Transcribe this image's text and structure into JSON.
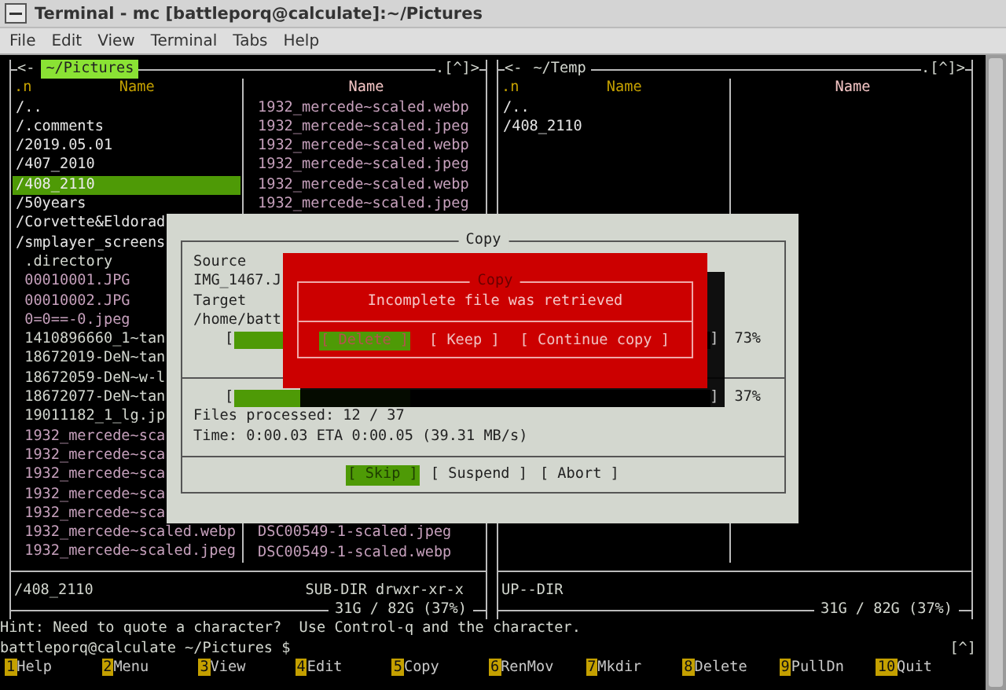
{
  "window": {
    "title": "Terminal - mc [battleporq@calculate]:~/Pictures"
  },
  "menu": [
    "File",
    "Edit",
    "View",
    "Terminal",
    "Tabs",
    "Help"
  ],
  "panels": [
    {
      "left_mark": "<-",
      "path": "~/Pictures",
      "selected": true,
      "right_mark": ".[^]>",
      "column_headers": [
        ".n",
        "Name",
        "Name"
      ],
      "column_1": [
        {
          "name": "/..",
          "kind": "dir",
          "selected": false
        },
        {
          "name": "/.comments",
          "kind": "dir",
          "selected": false
        },
        {
          "name": "/2019.05.01",
          "kind": "dir",
          "selected": false
        },
        {
          "name": "/407_2010",
          "kind": "dir",
          "selected": false
        },
        {
          "name": "/408_2110",
          "kind": "dir",
          "selected": true
        },
        {
          "name": "/50years",
          "kind": "dir",
          "selected": false
        },
        {
          "name": "/Corvette&Eldorad",
          "kind": "dir",
          "selected": false
        },
        {
          "name": "/smplayer_screens",
          "kind": "dir",
          "selected": false
        },
        {
          "name": ".directory",
          "kind": "file",
          "selected": false
        },
        {
          "name": "00010001.JPG",
          "kind": "image",
          "selected": false
        },
        {
          "name": "00010002.JPG",
          "kind": "image",
          "selected": false
        },
        {
          "name": "0=0==-0.jpeg",
          "kind": "image",
          "selected": false
        },
        {
          "name": "1410896660_1~tan",
          "kind": "file",
          "selected": false
        },
        {
          "name": "18672019-DeN~tan",
          "kind": "file",
          "selected": false
        },
        {
          "name": "18672059-DeN~w-l",
          "kind": "file",
          "selected": false
        },
        {
          "name": "18672077-DeN~tan",
          "kind": "file",
          "selected": false
        },
        {
          "name": "19011182_1_lg.jp",
          "kind": "file",
          "selected": false
        },
        {
          "name": "1932_mercede~sca",
          "kind": "image",
          "selected": false
        },
        {
          "name": "1932_mercede~sca",
          "kind": "image",
          "selected": false
        },
        {
          "name": "1932_mercede~sca",
          "kind": "image",
          "selected": false
        },
        {
          "name": "1932_mercede~sca",
          "kind": "image",
          "selected": false
        },
        {
          "name": "1932_mercede~sca",
          "kind": "image",
          "selected": false
        },
        {
          "name": "1932_mercede~scaled.webp",
          "kind": "image",
          "selected": false
        },
        {
          "name": "1932_mercede~scaled.jpeg",
          "kind": "image",
          "selected": false
        }
      ],
      "column_2_top": [
        {
          "name": "1932_mercede~scaled.webp",
          "kind": "image",
          "selected": false
        },
        {
          "name": "1932_mercede~scaled.jpeg",
          "kind": "image",
          "selected": false
        },
        {
          "name": "1932_mercede~scaled.webp",
          "kind": "image",
          "selected": false
        },
        {
          "name": "1932_mercede~scaled.jpeg",
          "kind": "image",
          "selected": false
        },
        {
          "name": "1932_mercede~scaled.webp",
          "kind": "image",
          "selected": false
        },
        {
          "name": "1932_mercede~scaled.jpeg",
          "kind": "image",
          "selected": false
        }
      ],
      "column_2_bottom": [
        {
          "name": "DSC00549-1-scaled.jpeg",
          "kind": "image",
          "selected": false
        },
        {
          "name": "DSC00549-1-scaled.webp",
          "kind": "image",
          "selected": false
        }
      ],
      "status_left": "/408_2110",
      "status_right": "SUB-DIR drwxr-xr-x",
      "disk": "31G / 82G (37%)"
    },
    {
      "left_mark": "<-",
      "path": "~/Temp",
      "selected": false,
      "right_mark": ".[^]>",
      "column_headers": [
        ".n",
        "Name",
        "Name"
      ],
      "column_1": [
        {
          "name": "/..",
          "kind": "dir",
          "selected": false
        },
        {
          "name": "/408_2110",
          "kind": "dir",
          "selected": false
        }
      ],
      "status_left": "UP--DIR",
      "disk": "31G / 82G (37%)"
    }
  ],
  "copy_dialog": {
    "title": "Copy",
    "source_label": "Source",
    "source": "IMG_1467.J",
    "target_label": "Target",
    "target": "/home/batt",
    "bars": [
      {
        "open": "[",
        "close": "]",
        "level": 0.73,
        "reading": "73%"
      },
      {
        "open": "[",
        "close": "]",
        "level": 0.37,
        "reading": "37%"
      }
    ],
    "files_processed": "Files processed: 12 / 37",
    "time": "Time: 0:00.03 ETA 0:00.05 (39.31 MB/s)",
    "buttons": [
      {
        "label": "[ Skip ]",
        "selected": true
      },
      {
        "label": "[ Suspend ]",
        "selected": false
      },
      {
        "label": "[ Abort ]",
        "selected": false
      }
    ]
  },
  "error_dialog": {
    "title": "Copy",
    "message": "Incomplete file was retrieved",
    "buttons": [
      {
        "label": "[ Delete ]",
        "selected": true
      },
      {
        "label": "[ Keep ]",
        "selected": false
      },
      {
        "label": "[ Continue copy ]",
        "selected": false
      }
    ]
  },
  "hint": "Hint: Need to quote a character?  Use Control-q and the character.",
  "prompt": "battleporq@calculate ~/Pictures $",
  "prompt_mark": "[^]",
  "function_keys": [
    {
      "number": "1",
      "label": "Help"
    },
    {
      "number": "2",
      "label": "Menu"
    },
    {
      "number": "3",
      "label": "View"
    },
    {
      "number": "4",
      "label": "Edit"
    },
    {
      "number": "5",
      "label": "Copy"
    },
    {
      "number": "6",
      "label": "RenMov"
    },
    {
      "number": "7",
      "label": "Mkdir"
    },
    {
      "number": "8",
      "label": "Delete"
    },
    {
      "number": "9",
      "label": "PullDn"
    },
    {
      "number": "10",
      "label": "Quit"
    }
  ]
}
